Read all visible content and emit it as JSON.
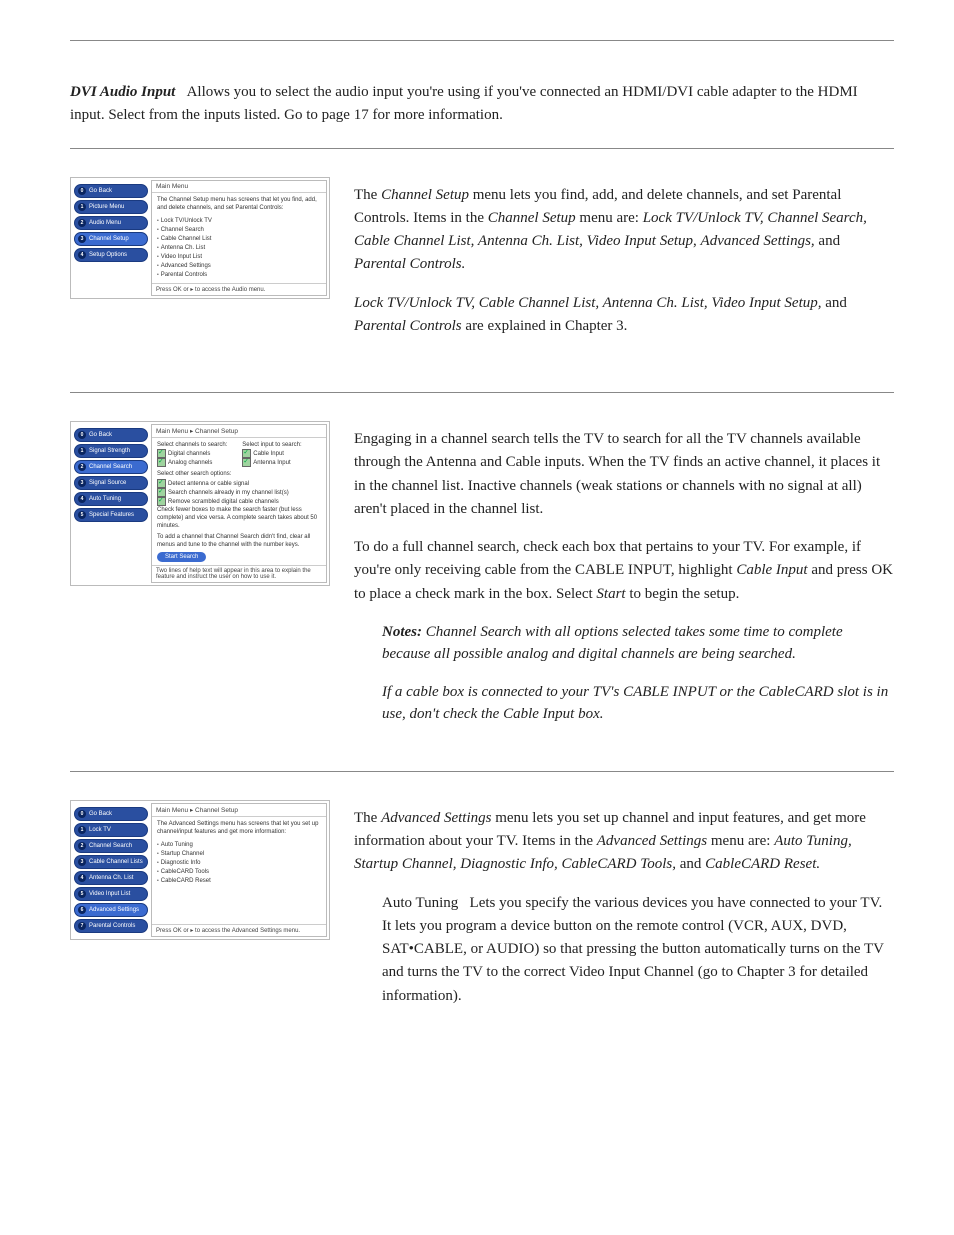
{
  "dvi": {
    "label": "DVI Audio Input",
    "text": "Allows you to select the audio input you're using if you've connected an HDMI/DVI cable adapter to the HDMI input. Select from the inputs listed. Go to page 17 for more information."
  },
  "fig1": {
    "title": "Main Menu",
    "side": [
      {
        "n": "0",
        "label": "Go Back"
      },
      {
        "n": "1",
        "label": "Picture Menu"
      },
      {
        "n": "2",
        "label": "Audio Menu"
      },
      {
        "n": "3",
        "label": "Channel Setup"
      },
      {
        "n": "4",
        "label": "Setup Options"
      }
    ],
    "desc": "The Channel Setup menu has screens that let you find, add, and delete channels, and set Parental Controls:",
    "items": [
      "Lock TV/Unlock TV",
      "Channel Search",
      "Cable Channel List",
      "Antenna Ch. List",
      "Video Input List",
      "Advanced Settings",
      "Parental Controls"
    ],
    "foot": "Press OK or ▸ to access the Audio menu."
  },
  "channel_setup": {
    "p1a": "The ",
    "p1b": "Channel Setup",
    "p1c": " menu lets you find, add, and delete channels, and set Parental Controls. Items in the ",
    "p1d": "Channel Setup",
    "p1e": " menu are: ",
    "p1f": "Lock TV/Unlock TV, Channel Search, Cable Channel List, Antenna Ch. List, Video Input Setup",
    "p1g": ", ",
    "p1h": "Advanced Settings,",
    "p1i": " and ",
    "p1j": "Parental Controls.",
    "p2a": "Lock TV/Unlock TV, Cable Channel List, Antenna Ch. List, Video Input Setup,",
    "p2b": " and ",
    "p2c": "Parental Controls",
    "p2d": " are explained in Chapter 3."
  },
  "fig2": {
    "title": "Main Menu ▸ Channel Setup",
    "side": [
      {
        "n": "0",
        "label": "Go Back"
      },
      {
        "n": "1",
        "label": "Signal Strength"
      },
      {
        "n": "2",
        "label": "Channel Search"
      },
      {
        "n": "3",
        "label": "Signal Source"
      },
      {
        "n": "4",
        "label": "Auto Tuning"
      },
      {
        "n": "5",
        "label": "Special Features"
      }
    ],
    "lcol_h": "Select channels to search:",
    "rcol_h": "Select input to search:",
    "l1": "Digital channels",
    "l2": "Analog channels",
    "r1": "Cable Input",
    "r2": "Antenna Input",
    "other_h": "Select other search options:",
    "o1": "Detect antenna or cable signal",
    "o2": "Search channels already in my channel list(s)",
    "o3": "Remove scrambled digital cable channels",
    "note": "Check fewer boxes to make the search faster (but less complete) and vice versa. A complete search takes about 50 minutes.",
    "add_note": "To add a channel that Channel Search didn't find, clear all menus and tune to the channel with the number keys.",
    "start": "Start Search",
    "foot": "Two lines of help text will appear in this area to explain the feature and instruct the user on how to use it."
  },
  "search": {
    "p1": "Engaging in a channel search tells the TV to search for all the TV channels available through the Antenna and Cable inputs. When the TV finds an active channel, it places it in the channel list. Inactive channels (weak stations or channels with no signal at all) aren't placed in the channel list.",
    "p2a": "To do a full channel search, check each box that pertains to your TV. For example, if you're only receiving cable from the CABLE INPUT, highlight ",
    "p2b": "Cable Input",
    "p2c": " and press OK to place a check mark in the box. Select ",
    "p2d": "Start",
    "p2e": " to begin the setup.",
    "n1_label": "Notes:",
    "n1": " Channel Search with all options selected takes some time to complete because all possible analog and digital channels are being searched.",
    "n2": "If a cable box is connected to your TV's CABLE INPUT or the CableCARD slot is in use, don't check the Cable Input box."
  },
  "fig3": {
    "title": "Main Menu ▸ Channel Setup",
    "side": [
      {
        "n": "0",
        "label": "Go Back"
      },
      {
        "n": "1",
        "label": "Lock TV"
      },
      {
        "n": "2",
        "label": "Channel Search"
      },
      {
        "n": "3",
        "label": "Cable Channel Lists"
      },
      {
        "n": "4",
        "label": "Antenna Ch. List"
      },
      {
        "n": "5",
        "label": "Video Input List"
      },
      {
        "n": "6",
        "label": "Advanced Settings"
      },
      {
        "n": "7",
        "label": "Parental Controls"
      }
    ],
    "desc": "The Advanced Settings menu has screens that let you set up channel/input features and get more information:",
    "items": [
      "Auto Tuning",
      "Startup Channel",
      "Diagnostic Info",
      "CableCARD Tools",
      "CableCARD Reset"
    ],
    "foot": "Press OK or ▸ to access the Advanced Settings menu."
  },
  "advanced": {
    "p1a": "The ",
    "p1b": "Advanced Settings",
    "p1c": " menu lets you set up channel and input features, and get more information about your TV. Items in the ",
    "p1d": "Advanced Settings",
    "p1e": " menu are: ",
    "p1f": "Auto Tuning, Startup Channel, Diagnostic Info, CableCARD Tools,",
    "p1g": " and ",
    "p1h": "CableCARD Reset.",
    "auto_label": "Auto Tuning",
    "auto_text": "Lets you specify the various devices you have connected to your TV. It lets you program a device button on the remote control (VCR, AUX, DVD, SAT•CABLE, or AUDIO) so that pressing the button automatically turns on the TV and turns the TV to the correct Video Input Channel (go to Chapter 3 for detailed information)."
  }
}
